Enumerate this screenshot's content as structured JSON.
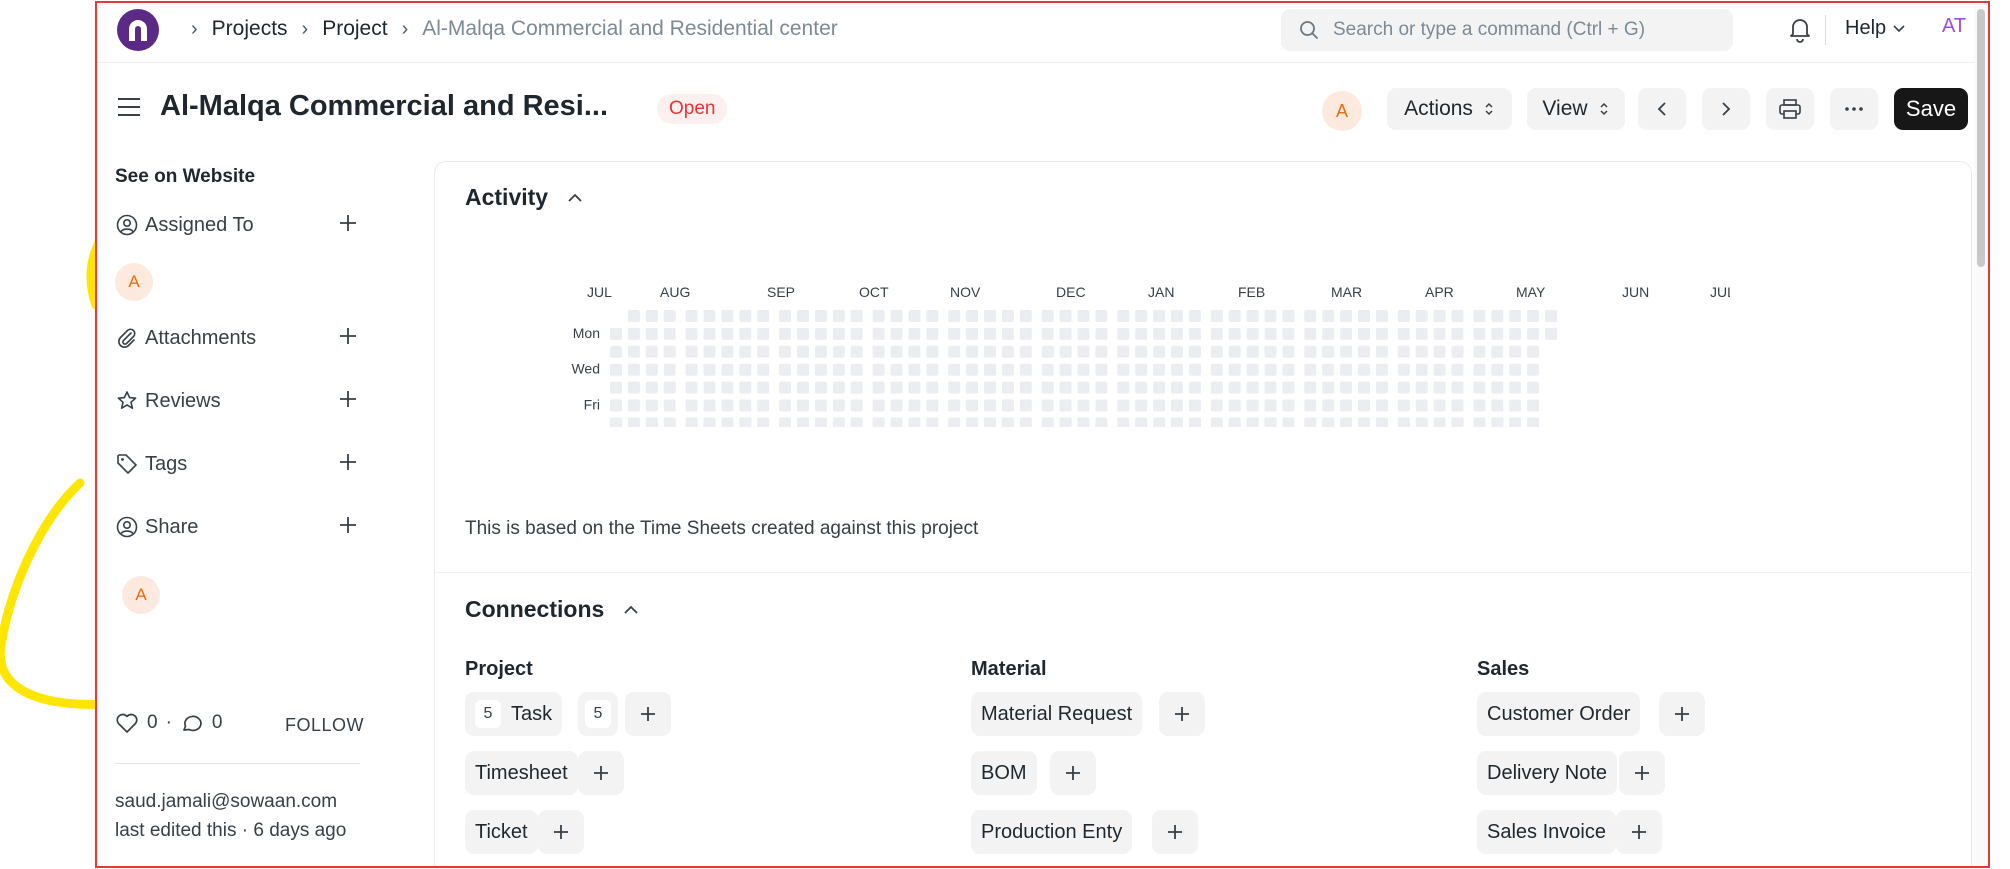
{
  "navbar": {
    "breadcrumbs": [
      "Projects",
      "Project",
      "Al-Malqa Commercial and Residential center"
    ],
    "search_placeholder": "Search or type a command (Ctrl + G)",
    "help_label": "Help",
    "user_initials": "AT"
  },
  "page": {
    "title": "Al-Malqa Commercial and Resi...",
    "status": "Open",
    "assignee_initial": "A",
    "actions_label": "Actions",
    "view_label": "View",
    "save_label": "Save"
  },
  "sidebar": {
    "see_on_website": "See on Website",
    "assigned_to": "Assigned To",
    "assigned_initial": "A",
    "attachments": "Attachments",
    "reviews": "Reviews",
    "tags": "Tags",
    "share": "Share",
    "share_initial": "A",
    "likes": "0",
    "comments": "0",
    "follow": "FOLLOW",
    "editor": "saud.jamali@sowaan.com",
    "edited_text": "last edited this · 6 days ago"
  },
  "activity": {
    "title": "Activity",
    "months": [
      "JUL",
      "AUG",
      "SEP",
      "OCT",
      "NOV",
      "DEC",
      "JAN",
      "FEB",
      "MAR",
      "APR",
      "MAY",
      "JUN",
      "JUL"
    ],
    "day_labels": [
      "Mon",
      "Wed",
      "Fri"
    ],
    "note": "This is based on the Time Sheets created against this project"
  },
  "connections": {
    "title": "Connections",
    "columns": [
      {
        "heading": "Project",
        "items": [
          {
            "label": "Task",
            "count": "5",
            "open_count": "5"
          },
          {
            "label": "Timesheet"
          },
          {
            "label": "Ticket"
          }
        ]
      },
      {
        "heading": "Material",
        "items": [
          {
            "label": "Material Request"
          },
          {
            "label": "BOM"
          },
          {
            "label": "Production Enty"
          }
        ]
      },
      {
        "heading": "Sales",
        "items": [
          {
            "label": "Customer Order"
          },
          {
            "label": "Delivery Note"
          },
          {
            "label": "Sales Invoice"
          }
        ]
      }
    ]
  },
  "colors": {
    "annotation": "#ffe600",
    "frame_border": "#e53935",
    "logo": "#5b2a86",
    "status_open_text": "#e03636",
    "heat_cell": "#ebedf0"
  }
}
